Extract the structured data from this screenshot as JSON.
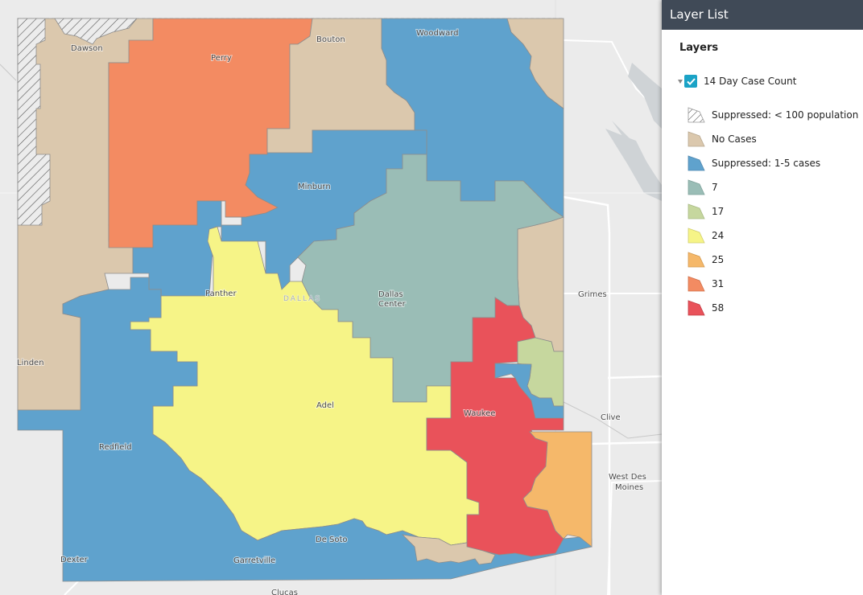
{
  "map": {
    "county_label": "DALLAS",
    "places": [
      {
        "name": "Dawson"
      },
      {
        "name": "Perry"
      },
      {
        "name": "Bouton"
      },
      {
        "name": "Woodward"
      },
      {
        "name": "Minburn"
      },
      {
        "name": "Panther"
      },
      {
        "name": "Dallas"
      },
      {
        "name": "Center"
      },
      {
        "name": "Grimes"
      },
      {
        "name": "Linden"
      },
      {
        "name": "Adel"
      },
      {
        "name": "Waukee"
      },
      {
        "name": "Clive"
      },
      {
        "name": "Redfield"
      },
      {
        "name": "West Des"
      },
      {
        "name": "Moines"
      },
      {
        "name": "De Soto"
      },
      {
        "name": "Dexter"
      },
      {
        "name": "Garretville"
      },
      {
        "name": "Clucas"
      }
    ],
    "colors": {
      "background": "#ebebeb",
      "suppressed_pop": "#ececec",
      "no_cases": "#dbc8ad",
      "suppressed_cases": "#5fa2cd",
      "c7": "#9abdb6",
      "c17": "#c6d79e",
      "c24": "#f6f487",
      "c25": "#f5b86a",
      "c31": "#f38b62",
      "c58": "#e9525a"
    }
  },
  "panel": {
    "title": "Layer List",
    "section_title": "Layers",
    "layer": {
      "name": "14 Day Case Count",
      "checked": true,
      "legend": [
        {
          "label": "Suppressed: < 100 population",
          "color": "#ffffff",
          "pattern": "hatch"
        },
        {
          "label": "No Cases",
          "color": "#dbc8ad"
        },
        {
          "label": "Suppressed: 1-5 cases",
          "color": "#5fa2cd"
        },
        {
          "label": "7",
          "color": "#9abdb6"
        },
        {
          "label": "17",
          "color": "#c6d79e"
        },
        {
          "label": "24",
          "color": "#f6f487"
        },
        {
          "label": "25",
          "color": "#f5b86a"
        },
        {
          "label": "31",
          "color": "#f38b62"
        },
        {
          "label": "58",
          "color": "#e9525a"
        }
      ]
    }
  }
}
